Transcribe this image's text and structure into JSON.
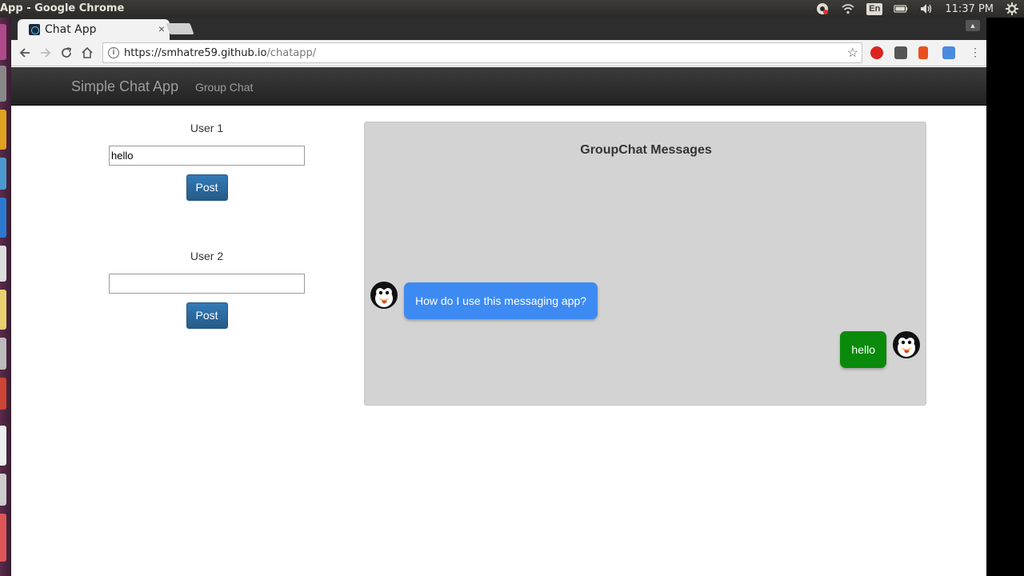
{
  "os": {
    "window_title": "App - Google Chrome",
    "keyboard_layout": "En",
    "clock": "11:37 PM",
    "tray_icons": [
      "chrome-sync-icon",
      "wifi-icon",
      "keyboard-layout-icon",
      "battery-icon",
      "volume-icon",
      "power-gear-icon"
    ]
  },
  "browser": {
    "tab_title": "Chat App",
    "tab_close": "×",
    "url_host": "https://smhatre59.github.io",
    "url_path": "/chatapp/",
    "extensions": [
      "adblock-icon",
      "pocket-icon",
      "office-icon",
      "extension-icon",
      "menu-icon"
    ]
  },
  "navbar": {
    "brand": "Simple Chat App",
    "link": "Group Chat"
  },
  "users": [
    {
      "label": "User 1",
      "input_value": "hello",
      "button": "Post"
    },
    {
      "label": "User 2",
      "input_value": "",
      "button": "Post"
    }
  ],
  "chat": {
    "title": "GroupChat Messages",
    "messages": [
      {
        "text": "How do I use this messaging app?",
        "side": "left",
        "color": "#3d8bf2"
      },
      {
        "text": "hello",
        "side": "right",
        "color": "#0a8a0a"
      }
    ]
  },
  "colors": {
    "navbar_bg": "#222222",
    "button_primary": "#337ab7",
    "chat_bg": "#d3d3d3"
  }
}
